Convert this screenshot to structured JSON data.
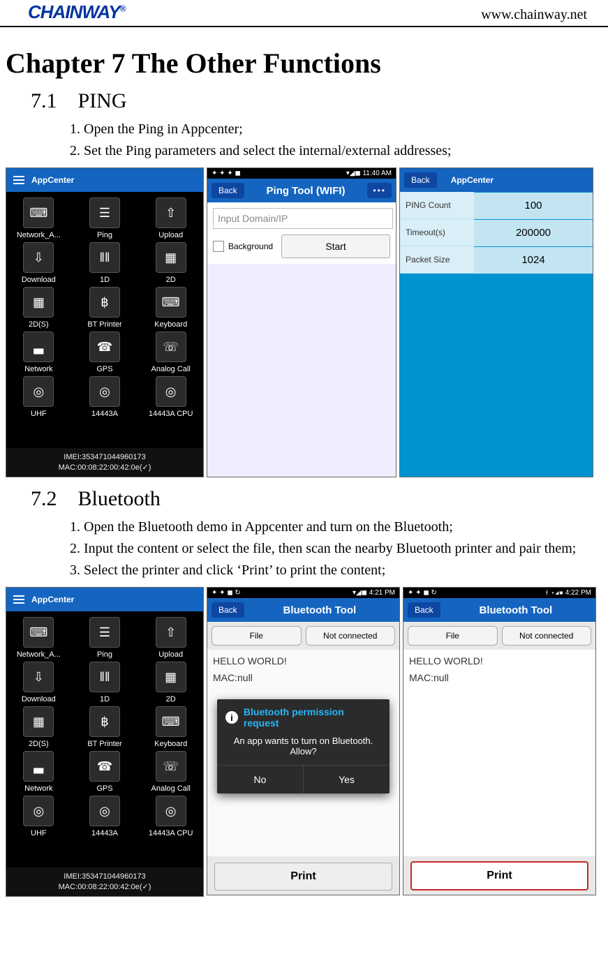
{
  "header": {
    "logo_text": "CHAINWAY",
    "logo_mark": "®",
    "url": "www.chainway.net"
  },
  "chapter_title": "Chapter 7 The Other Functions",
  "section_71": {
    "heading": "7.1 PING",
    "steps": [
      "Open the Ping in Appcenter;",
      "Set the Ping parameters and select the internal/external addresses;"
    ]
  },
  "section_72": {
    "heading": "7.2 Bluetooth",
    "steps": [
      "Open the Bluetooth demo in Appcenter and turn on the Bluetooth;",
      "Input the content or select the file, then scan the nearby Bluetooth printer and pair them;",
      "Select the printer and click ‘Print’ to print the content;"
    ]
  },
  "appcenter": {
    "title": "AppCenter",
    "items": [
      {
        "label": "Network_A...",
        "glyph": "⌨"
      },
      {
        "label": "Ping",
        "glyph": "☰"
      },
      {
        "label": "Upload",
        "glyph": "⇧"
      },
      {
        "label": "Download",
        "glyph": "⇩"
      },
      {
        "label": "1D",
        "glyph": "‖‖"
      },
      {
        "label": "2D",
        "glyph": "▦"
      },
      {
        "label": "2D(S)",
        "glyph": "▦"
      },
      {
        "label": "BT Printer",
        "glyph": "฿"
      },
      {
        "label": "Keyboard",
        "glyph": "⌨"
      },
      {
        "label": "Network",
        "glyph": "▃"
      },
      {
        "label": "GPS",
        "glyph": "☎"
      },
      {
        "label": "Analog Call",
        "glyph": "☏"
      },
      {
        "label": "UHF",
        "glyph": "◎"
      },
      {
        "label": "14443A",
        "glyph": "◎"
      },
      {
        "label": "14443A CPU",
        "glyph": "◎"
      }
    ],
    "footer_l1": "IMEI:353471044960173",
    "footer_l2": "MAC:00:08:22:00:42:0e(✓)"
  },
  "ping_tool": {
    "status_time": "11:40 AM",
    "back": "Back",
    "title": "Ping Tool (WIFI)",
    "more": "•••",
    "input_placeholder": "Input Domain/IP",
    "bg_label": "Background",
    "start": "Start"
  },
  "ping_settings": {
    "back": "Back",
    "title": "AppCenter",
    "rows": [
      {
        "label": "PING Count",
        "value": "100"
      },
      {
        "label": "Timeout(s)",
        "value": "200000"
      },
      {
        "label": "Packet Size",
        "value": "1024"
      }
    ]
  },
  "bt_tool": {
    "status_time_a": "4:21 PM",
    "status_time_b": "4:22 PM",
    "back": "Back",
    "title": "Bluetooth Tool",
    "btn_file": "File",
    "btn_status": "Not connected",
    "body_l1": "HELLO WORLD!",
    "body_l2": "MAC:null",
    "print": "Print",
    "dialog": {
      "title": "Bluetooth permission request",
      "msg": "An app wants to turn on Bluetooth. Allow?",
      "no": "No",
      "yes": "Yes"
    }
  }
}
